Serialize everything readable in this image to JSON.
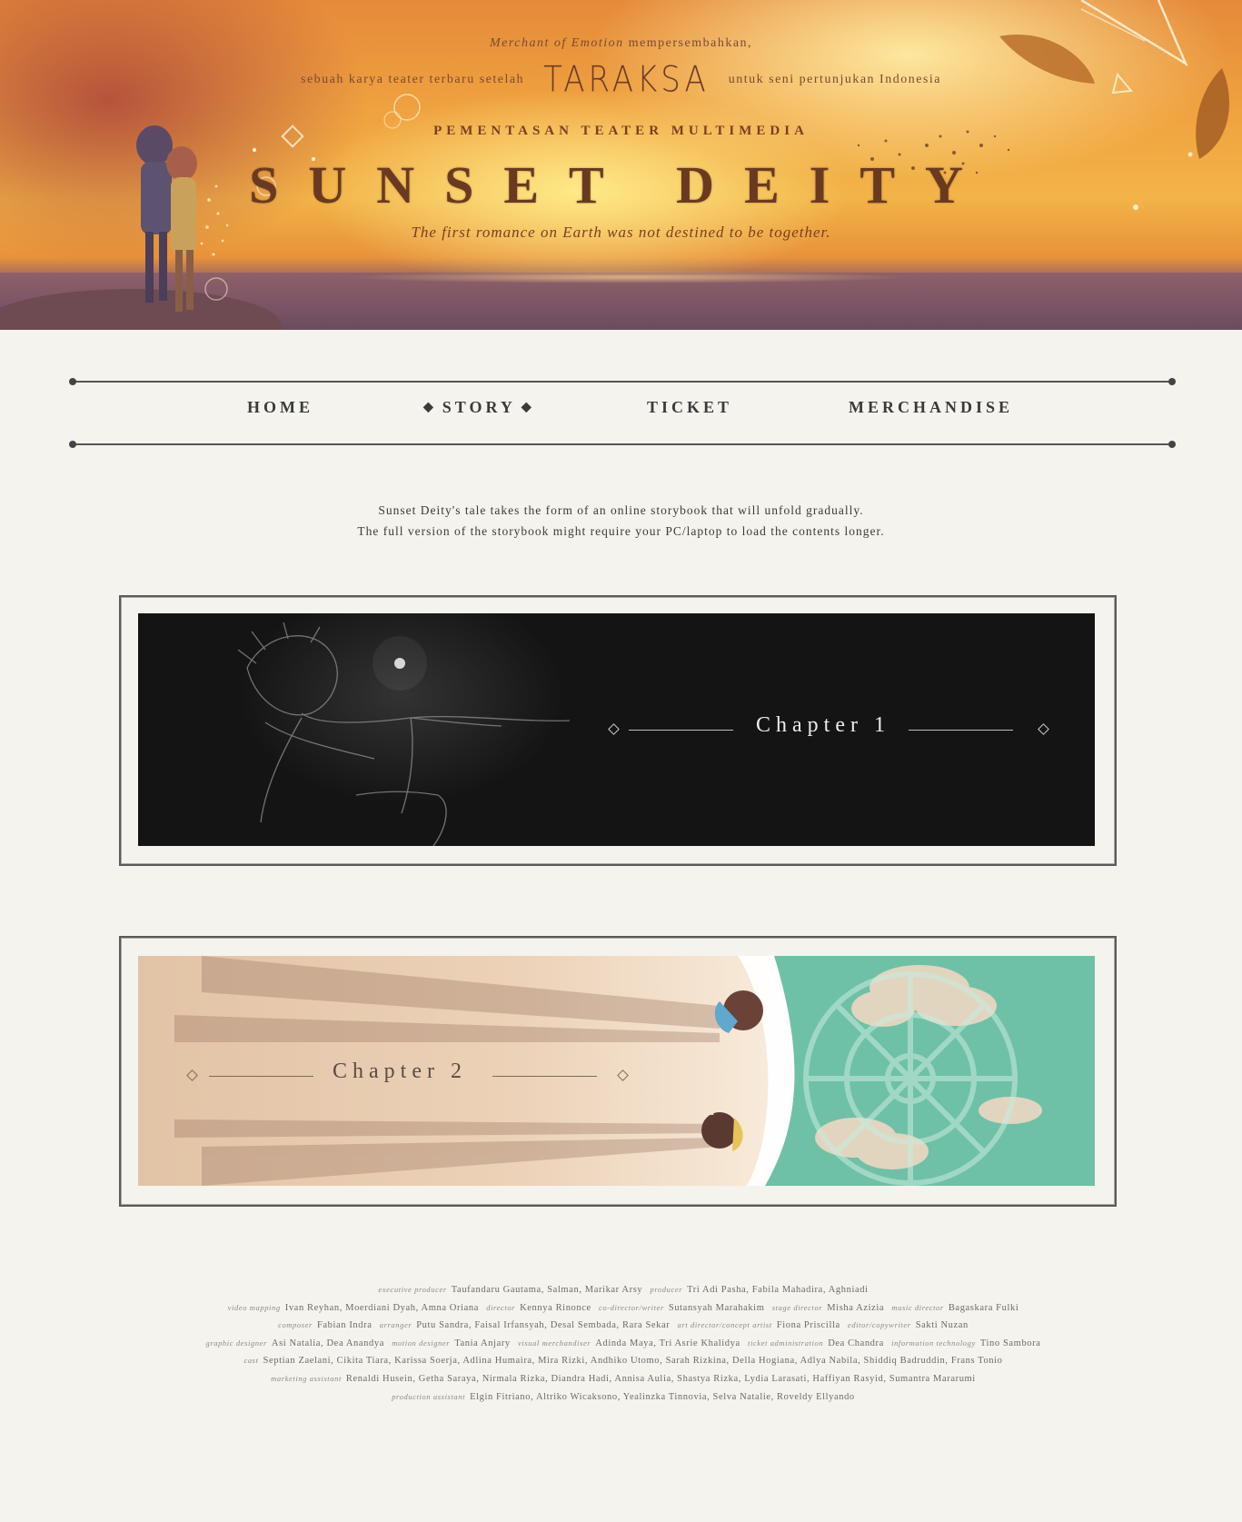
{
  "hero": {
    "presenter": "Merchant of Emotion",
    "presents": "mempersembahkan,",
    "line2_before": "sebuah karya teater terbaru setelah",
    "previous_work_logo": "TARAKSA",
    "line2_after": "untuk seni pertunjukan Indonesia",
    "subhead": "PEMENTASAN TEATER MULTIMEDIA",
    "title": "SUNSET DEITY",
    "tagline": "The first romance on Earth was not destined to be together."
  },
  "nav": {
    "items": [
      {
        "label": "HOME",
        "active": false
      },
      {
        "label": "STORY",
        "active": true
      },
      {
        "label": "TICKET",
        "active": false
      },
      {
        "label": "MERCHANDISE",
        "active": false
      }
    ],
    "active_marker": "◆"
  },
  "intro": {
    "line1": "Sunset Deity's tale takes the form of an online storybook that will unfold gradually.",
    "line2": "The full version of the storybook might require your PC/laptop to load the contents longer."
  },
  "chapters": [
    {
      "label": "Chapter 1"
    },
    {
      "label": "Chapter 2"
    }
  ],
  "credits": [
    [
      {
        "role": "executive producer",
        "names": "Taufandaru Gautama, Salman, Marikar Arsy"
      },
      {
        "role": "producer",
        "names": "Tri Adi Pasha, Fabila Mahadira, Aghniadi"
      }
    ],
    [
      {
        "role": "video mapping",
        "names": "Ivan Reyhan, Moerdiani Dyah, Amna Oriana"
      },
      {
        "role": "director",
        "names": "Kennya Rinonce"
      },
      {
        "role": "co-director/writer",
        "names": "Sutansyah Marahakim"
      },
      {
        "role": "stage director",
        "names": "Misha Azizia"
      },
      {
        "role": "music director",
        "names": "Bagaskara Fulki"
      }
    ],
    [
      {
        "role": "composer",
        "names": "Fabian Indra"
      },
      {
        "role": "arranger",
        "names": "Putu Sandra, Faisal Irfansyah, Desal Sembada, Rara Sekar"
      },
      {
        "role": "art director/concept artist",
        "names": "Fiona Priscilla"
      },
      {
        "role": "editor/copywriter",
        "names": "Sakti Nuzan"
      }
    ],
    [
      {
        "role": "graphic designer",
        "names": "Asi Natalia, Dea Anandya"
      },
      {
        "role": "motion designer",
        "names": "Tania Anjary"
      },
      {
        "role": "visual merchandiser",
        "names": "Adinda Maya, Tri Asrie Khalidya"
      },
      {
        "role": "ticket administration",
        "names": "Dea Chandra"
      },
      {
        "role": "information technology",
        "names": "Tino Sambora"
      }
    ],
    [
      {
        "role": "cast",
        "names": "Septian Zaelani, Cikita Tiara, Karissa Soerja, Adlina Humaira, Mira Rizki, Andhiko Utomo,  Sarah Rizkina, Della Hogiana, Adlya Nabila, Shiddiq Badruddin, Frans Tonio"
      }
    ],
    [
      {
        "role": "marketing assistant",
        "names": "Renaldi Husein, Getha Saraya, Nirmala Rizka, Diandra Hadi, Annisa Aulia, Shastya Rizka, Lydia Larasati, Haffiyan Rasyid, Sumantra Mararumi"
      }
    ],
    [
      {
        "role": "production assistant",
        "names": "Elgin Fitriano, Altriko Wicaksono,  Yealinzka Tinnovia, Selva Natalie, Roveldy Ellyando"
      }
    ]
  ],
  "colors": {
    "page_bg": "#f4f3ee",
    "text": "#3a3a3a",
    "hero_accent": "#7a3e22",
    "chapter1_bg": "#121212",
    "chapter2_sky": "#6ec1a6"
  }
}
